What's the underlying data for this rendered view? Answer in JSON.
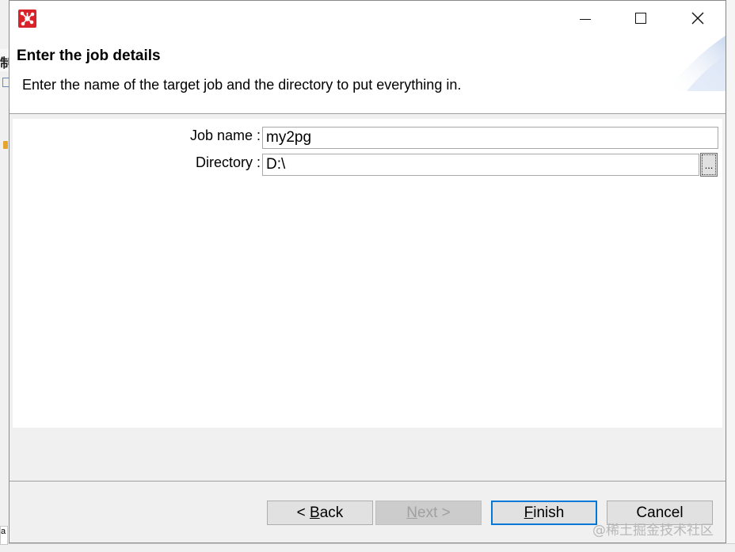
{
  "background": {
    "left_char": "制",
    "bottom_tab_char": "a"
  },
  "dialog": {
    "title": "Enter the job details",
    "description": "Enter the name of the target job and the directory to put everything in.",
    "accent_color": "#0078d7",
    "app_icon_color": "#d9232b"
  },
  "window_controls": {
    "minimize_icon": "minimize-icon",
    "maximize_icon": "maximize-icon",
    "close_icon": "close-icon"
  },
  "form": {
    "job_name_label": "Job name :",
    "job_name_value": "my2pg",
    "directory_label": "Directory :",
    "directory_value": "D:\\",
    "browse_label": "..."
  },
  "buttons": {
    "back_prefix": "< ",
    "back_mnemonic": "B",
    "back_rest": "ack",
    "next_mnemonic": "N",
    "next_rest": "ext >",
    "finish_mnemonic": "F",
    "finish_rest": "inish",
    "cancel_label": "Cancel"
  },
  "watermark": "@稀土掘金技术社区"
}
